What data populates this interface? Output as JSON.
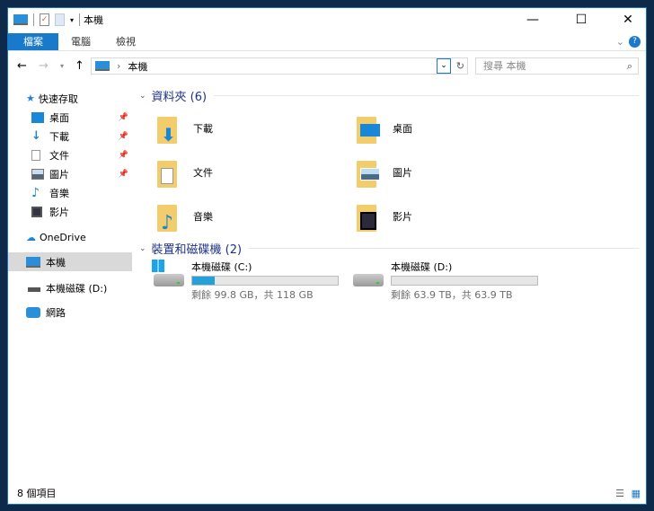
{
  "window": {
    "title": "本機"
  },
  "ribbon": {
    "tabs": [
      "檔案",
      "電腦",
      "檢視"
    ]
  },
  "address": {
    "path": "本機",
    "search_placeholder": "搜尋 本機"
  },
  "nav": {
    "quick_access": "快速存取",
    "items": [
      "桌面",
      "下載",
      "文件",
      "圖片",
      "音樂",
      "影片"
    ],
    "onedrive": "OneDrive",
    "this_pc": "本機",
    "drive_d": "本機磁碟 (D:)",
    "network": "網路"
  },
  "folders": {
    "header": "資料夾 (6)",
    "items": [
      "下載",
      "文件",
      "音樂",
      "桌面",
      "圖片",
      "影片"
    ]
  },
  "drives": {
    "header": "裝置和磁碟機 (2)",
    "items": [
      {
        "name": "本機磁碟 (C:)",
        "detail": "剩餘 99.8 GB，共 118 GB",
        "used_fraction": 0.154
      },
      {
        "name": "本機磁碟 (D:)",
        "detail": "剩餘 63.9 TB，共 63.9 TB",
        "used_fraction": 0.0
      }
    ]
  },
  "status": {
    "count": "8 個項目"
  },
  "colors": {
    "accent": "#1979ca",
    "header": "#1e3287",
    "bar": "#26a0da"
  }
}
